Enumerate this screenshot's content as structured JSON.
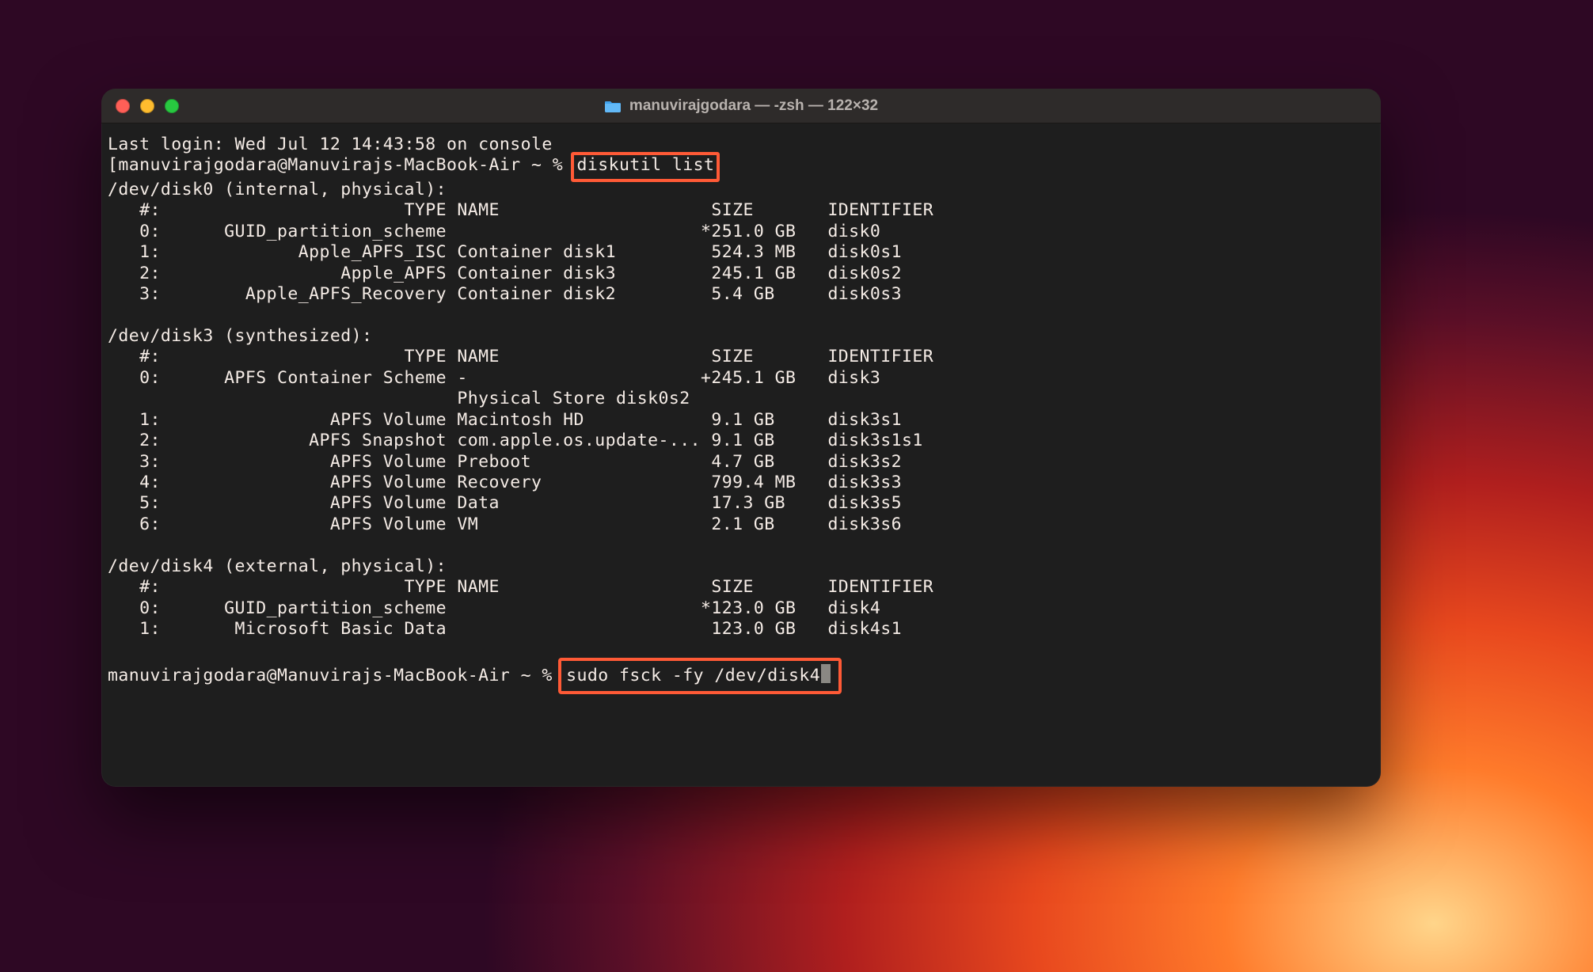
{
  "window": {
    "title": "manuvirajgodara — -zsh — 122×32"
  },
  "colors": {
    "highlight_border": "#ff5a36",
    "terminal_bg": "#1e1e1e",
    "titlebar_bg": "#2e2b2a",
    "text": "#f5ece6"
  },
  "last_login": "Last login: Wed Jul 12 14:43:58 on console",
  "prompt1_prefix": "[manuvirajgodara@Manuvirajs-MacBook-Air ~ % ",
  "prompt1_cmd": "diskutil list",
  "disk0_header": "/dev/disk0 (internal, physical):",
  "col_header": "   #:                       TYPE NAME                    SIZE       IDENTIFIER",
  "disk0_rows": [
    "   0:      GUID_partition_scheme                        *251.0 GB   disk0",
    "   1:             Apple_APFS_ISC Container disk1         524.3 MB   disk0s1",
    "   2:                 Apple_APFS Container disk3         245.1 GB   disk0s2",
    "   3:        Apple_APFS_Recovery Container disk2         5.4 GB     disk0s3"
  ],
  "disk3_header": "/dev/disk3 (synthesized):",
  "disk3_rows": [
    "   0:      APFS Container Scheme -                      +245.1 GB   disk3",
    "                                 Physical Store disk0s2",
    "   1:                APFS Volume Macintosh HD            9.1 GB     disk3s1",
    "   2:              APFS Snapshot com.apple.os.update-... 9.1 GB     disk3s1s1",
    "   3:                APFS Volume Preboot                 4.7 GB     disk3s2",
    "   4:                APFS Volume Recovery                799.4 MB   disk3s3",
    "   5:                APFS Volume Data                    17.3 GB    disk3s5",
    "   6:                APFS Volume VM                      2.1 GB     disk3s6"
  ],
  "disk4_header": "/dev/disk4 (external, physical):",
  "disk4_rows": [
    "   0:      GUID_partition_scheme                        *123.0 GB   disk4",
    "   1:       Microsoft Basic Data                         123.0 GB   disk4s1"
  ],
  "prompt2_prefix": "manuvirajgodara@Manuvirajs-MacBook-Air ~ % ",
  "prompt2_cmd": "sudo fsck -fy /dev/disk4"
}
